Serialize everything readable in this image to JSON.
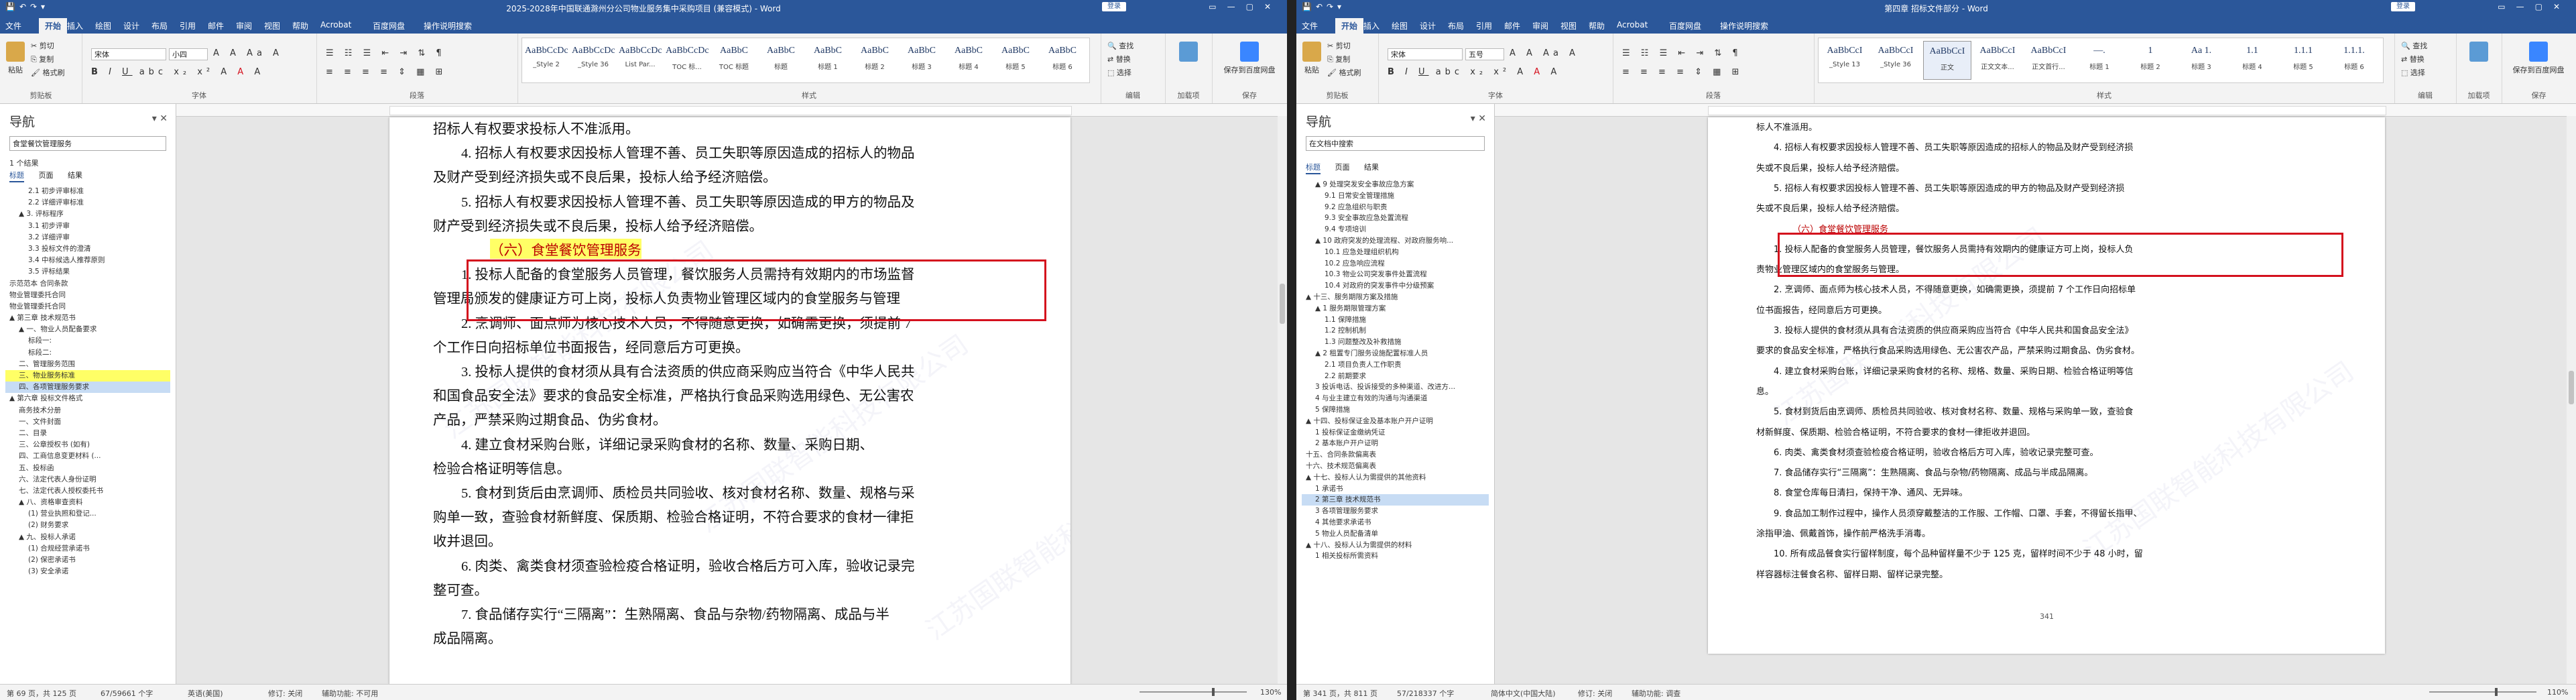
{
  "left": {
    "title": "2025-2028年中国联通滁州分公司物业服务集中采购项目 (兼容模式) - Word",
    "login": "登录",
    "tabs": [
      "文件",
      "开始",
      "插入",
      "绘图",
      "设计",
      "布局",
      "引用",
      "邮件",
      "审阅",
      "视图",
      "帮助",
      "Acrobat",
      "百度网盘",
      "操作说明搜索"
    ],
    "ribbon": {
      "paste": "粘贴",
      "cut": "剪切",
      "copy": "复制",
      "format_painter": "格式刷",
      "clipboard": "剪贴板",
      "font_name": "宋体",
      "font_size": "小四",
      "font_group": "字体",
      "paragraph_group": "段落",
      "styles_group": "样式",
      "find": "查找",
      "replace": "替换",
      "select": "选择",
      "edit_group": "编辑",
      "addin": "加载项",
      "save_baidu": "保存到百度网盘",
      "save_group": "保存"
    },
    "styles": [
      {
        "preview": "AaBbCcDc",
        "name": "_Style 2"
      },
      {
        "preview": "AaBbCcDc",
        "name": "_Style 36"
      },
      {
        "preview": "AaBbCcDc",
        "name": "List Par..."
      },
      {
        "preview": "AaBbCcDc",
        "name": "TOC 标..."
      },
      {
        "preview": "AaBbC",
        "name": "TOC 标题"
      },
      {
        "preview": "AaBbC",
        "name": "标题"
      },
      {
        "preview": "AaBbC",
        "name": "标题 1"
      },
      {
        "preview": "AaBbC",
        "name": "标题 2"
      },
      {
        "preview": "AaBbC",
        "name": "标题 3"
      },
      {
        "preview": "AaBbC",
        "name": "标题 4"
      },
      {
        "preview": "AaBbC",
        "name": "标题 5"
      },
      {
        "preview": "AaBbC",
        "name": "标题 6"
      }
    ],
    "nav": {
      "title": "导航",
      "search": "食堂餐饮管理服务",
      "count": "1 个结果",
      "tabs": [
        "标题",
        "页面",
        "结果"
      ],
      "items": [
        {
          "text": "2.1 初步评审标准",
          "indent": 2,
          "cls": ""
        },
        {
          "text": "2.2 详细评审标准",
          "indent": 2,
          "cls": ""
        },
        {
          "text": "▲ 3. 评标程序",
          "indent": 1,
          "cls": ""
        },
        {
          "text": "3.1 初步评审",
          "indent": 2,
          "cls": ""
        },
        {
          "text": "3.2 详细评审",
          "indent": 2,
          "cls": ""
        },
        {
          "text": "3.3 投标文件的澄清",
          "indent": 2,
          "cls": ""
        },
        {
          "text": "3.4 中标候选人推荐原则",
          "indent": 2,
          "cls": ""
        },
        {
          "text": "3.5 评标结果",
          "indent": 2,
          "cls": ""
        },
        {
          "text": "示范范本 合同条款",
          "indent": 0,
          "cls": ""
        },
        {
          "text": "物业管理委托合同",
          "indent": 0,
          "cls": ""
        },
        {
          "text": "物业管理委托合同",
          "indent": 0,
          "cls": ""
        },
        {
          "text": "▲ 第三章 技术规范书",
          "indent": 0,
          "cls": ""
        },
        {
          "text": "▲ 一、物业人员配备要求",
          "indent": 1,
          "cls": ""
        },
        {
          "text": "标段一:",
          "indent": 2,
          "cls": ""
        },
        {
          "text": "标段二:",
          "indent": 2,
          "cls": ""
        },
        {
          "text": "二、管理服务范围",
          "indent": 1,
          "cls": ""
        },
        {
          "text": "三、物业服务标准",
          "indent": 1,
          "cls": "hl"
        },
        {
          "text": "四、各项管理服务要求",
          "indent": 1,
          "cls": "sel"
        },
        {
          "text": "▲ 第六章 投标文件格式",
          "indent": 0,
          "cls": ""
        },
        {
          "text": "商务技术分册",
          "indent": 1,
          "cls": ""
        },
        {
          "text": "一、文件封面",
          "indent": 1,
          "cls": ""
        },
        {
          "text": "二、目录",
          "indent": 1,
          "cls": ""
        },
        {
          "text": "三、公章授权书 (如有)",
          "indent": 1,
          "cls": ""
        },
        {
          "text": "四、工商信息变更材料 (...",
          "indent": 1,
          "cls": ""
        },
        {
          "text": "五、投标函",
          "indent": 1,
          "cls": ""
        },
        {
          "text": "六、法定代表人身份证明",
          "indent": 1,
          "cls": ""
        },
        {
          "text": "七、法定代表人授权委托书",
          "indent": 1,
          "cls": ""
        },
        {
          "text": "▲ 八、资格审查资料",
          "indent": 1,
          "cls": ""
        },
        {
          "text": "(1) 营业执照和登记...",
          "indent": 2,
          "cls": ""
        },
        {
          "text": "(2) 财务要求",
          "indent": 2,
          "cls": ""
        },
        {
          "text": "▲ 九、投标人承诺",
          "indent": 1,
          "cls": ""
        },
        {
          "text": "(1) 合规经营承诺书",
          "indent": 2,
          "cls": ""
        },
        {
          "text": "(2) 保密承诺书",
          "indent": 2,
          "cls": ""
        },
        {
          "text": "(3) 安全承诺",
          "indent": 2,
          "cls": ""
        }
      ]
    },
    "doc": [
      "招标人有权要求投标人不准派用。",
      "4. 招标人有权要求因投标人管理不善、员工失职等原因造成的招标人的物品",
      "及财产受到经济损失或不良后果，投标人给予经济赔偿。",
      "5. 招标人有权要求因投标人管理不善、员工失职等原因造成的甲方的物品及",
      "财产受到经济损失或不良后果，投标人给予经济赔偿。",
      "（六）食堂餐饮管理服务",
      "1. 投标人配备的食堂服务人员管理，餐饮服务人员需持有效期内的市场监督",
      "管理局颁发的健康证方可上岗，投标人负责物业管理区域内的食堂服务与管理",
      "2. 烹调师、面点师为核心技术人员，不得随意更换，如确需更换，须提前 7",
      "个工作日向招标单位书面报告，经同意后方可更换。",
      "3. 投标人提供的食材须从具有合法资质的供应商采购应当符合《中华人民共",
      "和国食品安全法》要求的食品安全标准，严格执行食品采购选用绿色、无公害农",
      "产品，严禁采购过期食品、伪劣食材。",
      "4. 建立食材采购台账，详细记录采购食材的名称、数量、采购日期、",
      "检验合格证明等信息。",
      "5. 食材到货后由烹调师、质检员共同验收、核对食材名称、数量、规格与采",
      "购单一致，查验食材新鲜度、保质期、检验合格证明，不符合要求的食材一律拒",
      "收并退回。",
      "6. 肉类、禽类食材须查验检疫合格证明，验收合格后方可入库，验收记录完",
      "整可查。",
      "7. 食品储存实行“三隔离”：生熟隔离、食品与杂物/药物隔离、成品与半",
      "成品隔离。"
    ],
    "watermark": "江苏国联智能科技有限公司",
    "status": {
      "page": "第 69 页，共 125 页",
      "words": "67/59661 个字",
      "lang": "英语(美国)",
      "track": "修订: 关闭",
      "access": "辅助功能: 不可用",
      "zoom": "130%"
    }
  },
  "right": {
    "title": "第四章 招标文件部分 - Word",
    "login": "登录",
    "tabs": [
      "文件",
      "开始",
      "插入",
      "绘图",
      "设计",
      "布局",
      "引用",
      "邮件",
      "审阅",
      "视图",
      "帮助",
      "Acrobat",
      "百度网盘",
      "操作说明搜索"
    ],
    "ribbon": {
      "paste": "粘贴",
      "cut": "剪切",
      "copy": "复制",
      "format_painter": "格式刷",
      "clipboard": "剪贴板",
      "font_name": "宋体",
      "font_size": "五号",
      "font_group": "字体",
      "paragraph_group": "段落",
      "styles_group": "样式",
      "find": "查找",
      "replace": "替换",
      "select": "选择",
      "edit_group": "编辑",
      "addin": "加载项",
      "save_baidu": "保存到百度网盘",
      "save_group": "保存"
    },
    "styles": [
      {
        "preview": "AaBbCcI",
        "name": "_Style 13"
      },
      {
        "preview": "AaBbCcI",
        "name": "_Style 36"
      },
      {
        "preview": "AaBbCcI",
        "name": "正文"
      },
      {
        "preview": "AaBbCcI",
        "name": "正文文本..."
      },
      {
        "preview": "AaBbCcI",
        "name": "正文首行..."
      },
      {
        "preview": "—.",
        "name": "标题 1"
      },
      {
        "preview": "1",
        "name": "标题 2"
      },
      {
        "preview": "Aa 1.",
        "name": "标题 3"
      },
      {
        "preview": "1.1",
        "name": "标题 4"
      },
      {
        "preview": "1.1.1",
        "name": "标题 5"
      },
      {
        "preview": "1.1.1.",
        "name": "标题 6"
      }
    ],
    "nav": {
      "title": "导航",
      "search": "在文档中搜索",
      "tabs": [
        "标题",
        "页面",
        "结果"
      ],
      "items": [
        {
          "text": "▲ 9 处理突发安全事故应急方案",
          "indent": 1,
          "cls": ""
        },
        {
          "text": "9.1 日常安全管理措施",
          "indent": 2,
          "cls": ""
        },
        {
          "text": "9.2 应急组织与职责",
          "indent": 2,
          "cls": ""
        },
        {
          "text": "9.3 安全事故应急处置流程",
          "indent": 2,
          "cls": ""
        },
        {
          "text": "9.4 专项培训",
          "indent": 2,
          "cls": ""
        },
        {
          "text": "▲ 10 政府突发的处理流程、对政府服务响...",
          "indent": 1,
          "cls": ""
        },
        {
          "text": "10.1 应急处理组织机构",
          "indent": 2,
          "cls": ""
        },
        {
          "text": "10.2 应急响应流程",
          "indent": 2,
          "cls": ""
        },
        {
          "text": "10.3 物业公司突发事件处置流程",
          "indent": 2,
          "cls": ""
        },
        {
          "text": "10.4 对政府的突发事件中分级预案",
          "indent": 2,
          "cls": ""
        },
        {
          "text": "▲ 十三、服务期限方案及措施",
          "indent": 0,
          "cls": ""
        },
        {
          "text": "▲ 1 服务期限管理方案",
          "indent": 1,
          "cls": ""
        },
        {
          "text": "1.1 保障措施",
          "indent": 2,
          "cls": ""
        },
        {
          "text": "1.2 控制机制",
          "indent": 2,
          "cls": ""
        },
        {
          "text": "1.3 问题整改及补救措施",
          "indent": 2,
          "cls": ""
        },
        {
          "text": "▲ 2 租置专门服务设施配置标准人员",
          "indent": 1,
          "cls": ""
        },
        {
          "text": "2.1 项目负责人工作职责",
          "indent": 2,
          "cls": ""
        },
        {
          "text": "2.2 前期要求",
          "indent": 2,
          "cls": ""
        },
        {
          "text": "3 投诉电话、投诉接受的多种渠道、改进方...",
          "indent": 1,
          "cls": ""
        },
        {
          "text": "4 与业主建立有效的沟通与沟通渠道",
          "indent": 1,
          "cls": ""
        },
        {
          "text": "5 保障措施",
          "indent": 1,
          "cls": ""
        },
        {
          "text": "▲ 十四、投标保证金及基本账户开户证明",
          "indent": 0,
          "cls": ""
        },
        {
          "text": "1 投标保证金缴纳凭证",
          "indent": 1,
          "cls": ""
        },
        {
          "text": "2 基本账户开户证明",
          "indent": 1,
          "cls": ""
        },
        {
          "text": "十五、合同条款偏离表",
          "indent": 0,
          "cls": ""
        },
        {
          "text": "十六、技术规范偏离表",
          "indent": 0,
          "cls": ""
        },
        {
          "text": "▲ 十七、投标人认为需提供的其他资料",
          "indent": 0,
          "cls": ""
        },
        {
          "text": "1 承诺书",
          "indent": 1,
          "cls": ""
        },
        {
          "text": "2 第三章 技术规范书",
          "indent": 1,
          "cls": "sel"
        },
        {
          "text": "3 各项管理服务要求",
          "indent": 1,
          "cls": ""
        },
        {
          "text": "4 其他要求承诺书",
          "indent": 1,
          "cls": ""
        },
        {
          "text": "5 物业人员配备清单",
          "indent": 1,
          "cls": ""
        },
        {
          "text": "▲ 十八、投标人认为需提供的材料",
          "indent": 0,
          "cls": ""
        },
        {
          "text": "1 相关投标所需资料",
          "indent": 1,
          "cls": ""
        }
      ]
    },
    "doc": [
      "标人不准派用。",
      "4. 招标人有权要求因投标人管理不善、员工失职等原因造成的招标人的物品及财产受到经济损",
      "失或不良后果，投标人给予经济赔偿。",
      "5. 招标人有权要求因投标人管理不善、员工失职等原因造成的甲方的物品及财产受到经济损",
      "失或不良后果，投标人给予经济赔偿。",
      "（六）食堂餐饮管理服务",
      "1. 投标人配备的食堂服务人员管理，餐饮服务人员需持有效期内的健康证方可上岗，投标人负",
      "责物业管理区域内的食堂服务与管理。",
      "2. 烹调师、面点师为核心技术人员，不得随意更换，如确需更换，须提前 7 个工作日向招标单",
      "位书面报告，经同意后方可更换。",
      "3. 投标人提供的食材须从具有合法资质的供应商采购应当符合《中华人民共和国食品安全法》",
      "要求的食品安全标准，严格执行食品采购选用绿色、无公害农产品，严禁采购过期食品、伪劣食材。",
      "4. 建立食材采购台账，详细记录采购食材的名称、规格、数量、采购日期、检验合格证明等信",
      "息。",
      "5. 食材到货后由烹调师、质检员共同验收、核对食材名称、数量、规格与采购单一致，查验食",
      "材新鲜度、保质期、检验合格证明，不符合要求的食材一律拒收并退回。",
      "6. 肉类、禽类食材须查验检疫合格证明，验收合格后方可入库，验收记录完整可查。",
      "7. 食品储存实行“三隔离”：生熟隔离、食品与杂物/药物隔离、成品与半成品隔离。",
      "8. 食堂仓库每日清扫，保持干净、通风、无异味。",
      "9. 食品加工制作过程中，操作人员须穿戴整洁的工作服、工作帽、口罩、手套，不得留长指甲、",
      "涂指甲油、佩戴首饰，操作前严格洗手消毒。",
      "10. 所有成品餐食实行留样制度，每个品种留样量不少于 125 克，留样时间不少于 48 小时，留",
      "样容器标注餐食名称、留样日期、留样记录完整。"
    ],
    "page_number": "341",
    "watermark": "江苏国联智能科技有限公司",
    "status": {
      "page": "第 341 页，共 811 页",
      "words": "57/218337 个字",
      "lang": "简体中文(中国大陆)",
      "track": "修订: 关闭",
      "access": "辅助功能: 调查",
      "zoom": "110%"
    }
  }
}
